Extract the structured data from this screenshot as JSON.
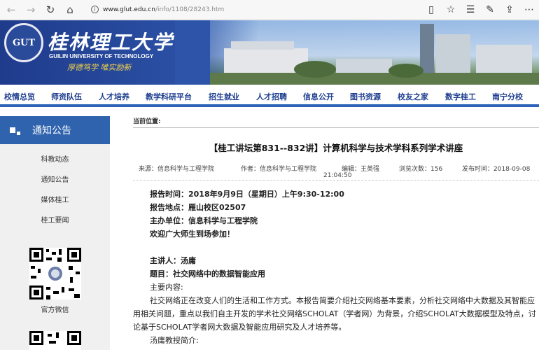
{
  "browser": {
    "url_domain": "www.glut.edu.cn",
    "url_path": "/info/1108/28243.htm",
    "back_icon": "←",
    "forward_icon": "→",
    "refresh_icon": "↻",
    "home_icon": "⌂",
    "reader_icon": "▯",
    "star_icon": "☆",
    "favorites_icon": "☰",
    "pen_icon": "✎",
    "share_icon": "⇪",
    "more_icon": "⋯"
  },
  "banner": {
    "logo_text": "GUT",
    "name_cn": "桂林理工大学",
    "name_en": "GUILIN UNIVERSITY OF TECHNOLOGY",
    "motto": "厚德笃学 唯实励新"
  },
  "nav": [
    "校情总览",
    "师资队伍",
    "人才培养",
    "教学科研平台",
    "招生就业",
    "人才招聘",
    "信息公开",
    "图书资源",
    "校友之家",
    "数字桂工",
    "南宁分校"
  ],
  "sidebar": {
    "heading": "通知公告",
    "items": [
      "科教动态",
      "通知公告",
      "媒体桂工",
      "桂工要闻"
    ],
    "qr_label": "官方微信"
  },
  "article": {
    "breadcrumb": "当前位置:",
    "title": "【桂工讲坛第831--832讲】计算机科学与技术学科系列学术讲座",
    "source": "来源：信息科学与工程学院",
    "author": "作者：信息科学与工程学院",
    "editor": "编辑：王英强",
    "views": "浏览次数：156",
    "time": "发布时间：2018-09-08",
    "time2": "21:04:50",
    "lines": [
      "报告时间：2018年9月9日（星期日）上午9:30-12:00",
      "报告地点：雁山校区02507",
      "主办单位：信息科学与工程学院",
      "欢迎广大师生到场参加！"
    ],
    "speaker": "主讲人：汤庸",
    "topic": "题目：社交网络中的数据智能应用",
    "summary_label": "主要内容:",
    "summary": "社交网络正在改变人们的生活和工作方式。本报告简要介绍社交网络基本要素，分析社交网络中大数据及其智能应用相关问题，重点以我们自主开发的学术社交网络SCHOLAT（学者网）为背景，介绍SCHOLAT大数据模型及特点，讨论基于SCHOLAT学者网大数据及智能应用研究及人才培养等。",
    "bio_label": "汤庸教授简介:"
  }
}
